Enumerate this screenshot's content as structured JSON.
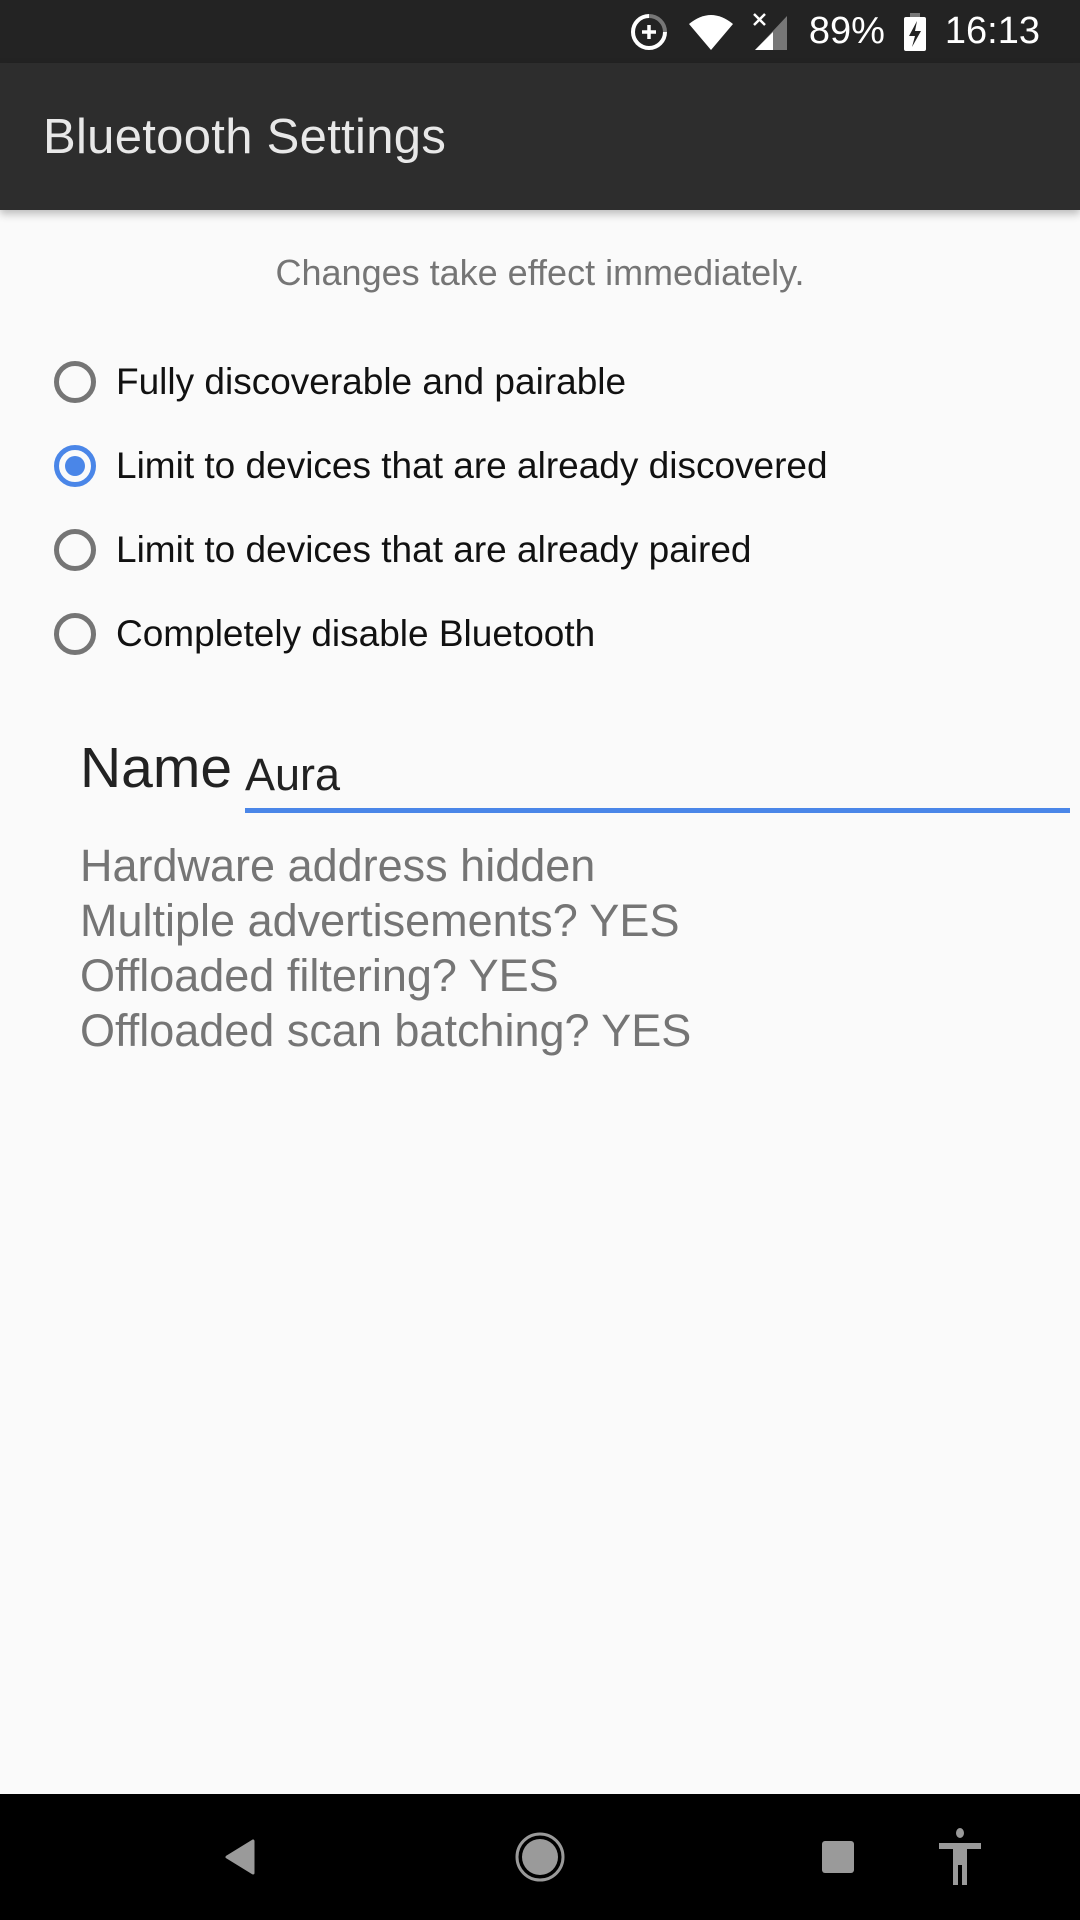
{
  "status_bar": {
    "battery_percent": "89%",
    "time": "16:13",
    "icons": [
      "data-saver-icon",
      "wifi-icon",
      "cell-signal-no-service-icon",
      "battery-charging-icon"
    ]
  },
  "app_bar": {
    "title": "Bluetooth Settings"
  },
  "main": {
    "hint": "Changes take effect immediately.",
    "mode_options": [
      {
        "label": "Fully discoverable and pairable",
        "selected": false
      },
      {
        "label": "Limit to devices that are already discovered",
        "selected": true
      },
      {
        "label": "Limit to devices that are already paired",
        "selected": false
      },
      {
        "label": "Completely disable Bluetooth",
        "selected": false
      }
    ],
    "name_label": "Name",
    "name_value": "Aura",
    "info_lines": [
      "Hardware address hidden",
      "Multiple advertisements? YES",
      "Offloaded filtering? YES",
      "Offloaded scan batching? YES"
    ]
  },
  "colors": {
    "accent": "#4a86e8",
    "app_bar": "#2d2d2d",
    "status_bar": "#232323",
    "background": "#fafafa"
  },
  "nav_bar": {
    "buttons": [
      "back",
      "home",
      "recents",
      "accessibility"
    ]
  }
}
